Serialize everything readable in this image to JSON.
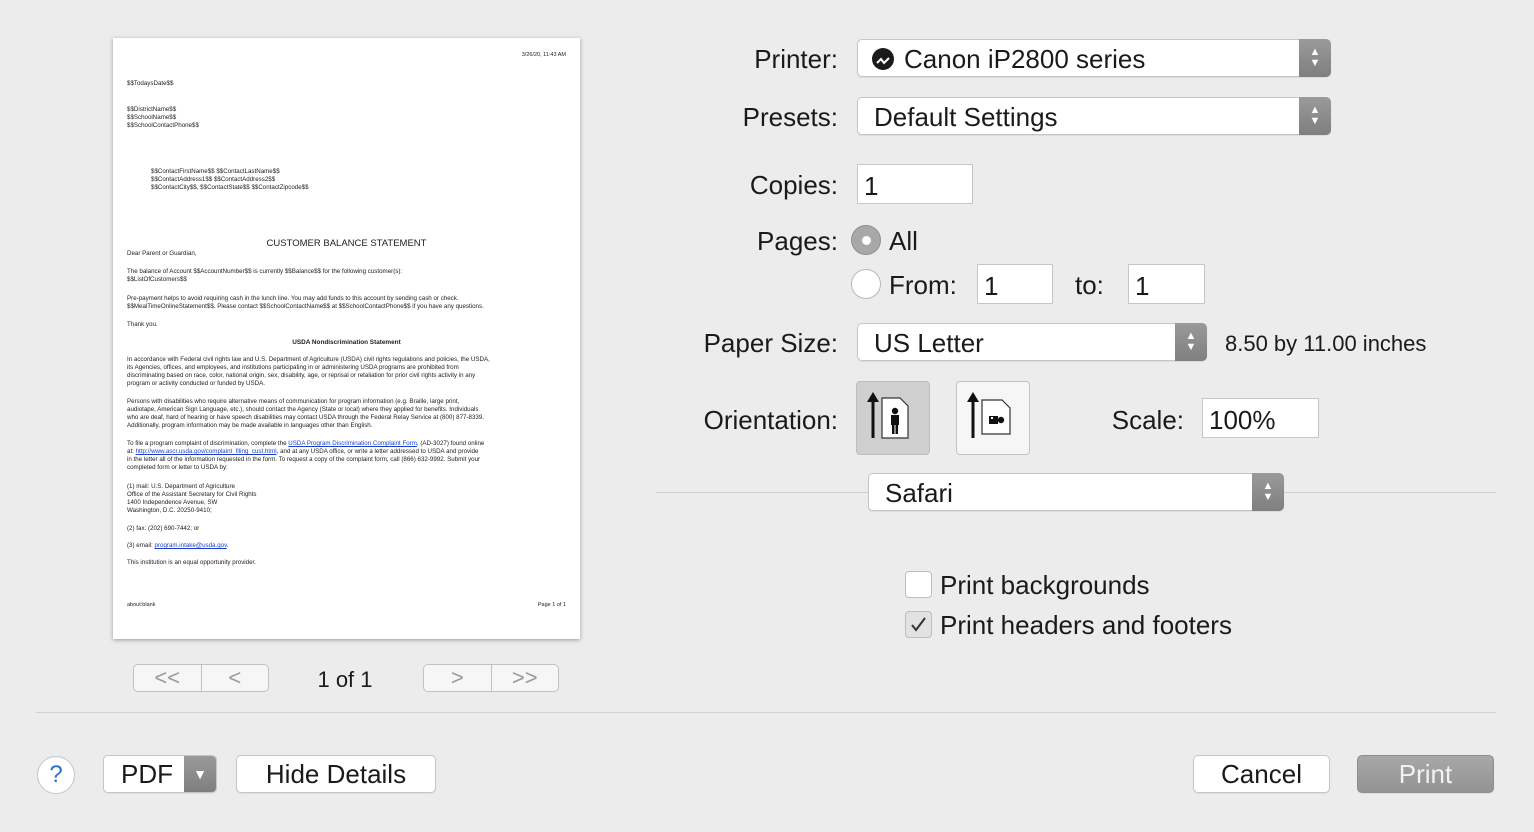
{
  "preview": {
    "timestamp": "3/26/20, 11:43 AM",
    "lines_top": [
      "$$TodaysDate$$",
      "$$DistrictName$$",
      "$$SchoolName$$",
      "$$SchoolContactPhone$$"
    ],
    "address_lines": [
      "$$ContactFirstName$$ $$ContactLastName$$",
      "$$ContactAddress1$$ $$ContactAddress2$$",
      "$$ContactCity$$, $$ContactState$$ $$ContactZipcode$$"
    ],
    "title": "CUSTOMER BALANCE STATEMENT",
    "greeting": "Dear Parent or Guardian,",
    "balance_lines": [
      "The balance of Account $$AccountNumber$$ is currently $$Balance$$ for the following customer(s):",
      "$$ListOfCustomers$$"
    ],
    "prepay_lines": [
      "Pre-payment helps to avoid requiring cash in the lunch line. You may add funds to this account by sending cash or check.",
      "$$MealTimeOnlineStatement$$. Please contact $$SchoolContactName$$ at $$SchoolContactPhone$$ if you have any questions."
    ],
    "thanks": "Thank you.",
    "subtitle": "USDA Nondiscrimination Statement",
    "para1": [
      "In accordance with Federal civil rights law and U.S. Department of Agriculture (USDA) civil rights regulations and policies, the USDA,",
      "its Agencies, offices, and employees, and institutions participating in or administering USDA programs are prohibited from",
      "discriminating based on race, color, national origin, sex, disability, age, or reprisal or retaliation for prior civil rights activity in any",
      "program or activity conducted or funded by USDA."
    ],
    "para2": [
      "Persons with disabilities who require alternative means of communication for program information (e.g. Braille, large print,",
      "audiotape, American Sign Language, etc.), should contact the Agency (State or local) where they applied for benefits. Individuals",
      "who are deaf, hard of hearing or have speech disabilities may contact USDA through the Federal Relay Service at (800) 877-8339.",
      "Additionally, program information may be made available in languages other than English."
    ],
    "para3_pre": "To file a program complaint of discrimination, complete the ",
    "para3_link": "USDA Program Discrimination Complaint Form",
    "para3_post": ", (AD-3027) found online",
    "para3_at": "at: ",
    "para3_link2": "http://www.ascr.usda.gov/complaint_filing_cust.html",
    "para3_post2": ", and at any USDA office, or write a letter addressed to USDA and provide",
    "para3_rest": [
      "in the letter all of the information requested in the form. To request a copy of the complaint form, call (866) 632-9992. Submit your",
      "completed form or letter to USDA by:"
    ],
    "mail_lines": [
      "(1) mail: U.S. Department of Agriculture",
      "Office of the Assistant Secretary for Civil Rights",
      "1400 Independence Avenue, SW",
      "Washington, D.C. 20250-9410;"
    ],
    "fax": "(2) fax: (202) 690-7442; or",
    "email_pre": "(3) email: ",
    "email_link": "program.intake@usda.gov",
    "email_post": ".",
    "equal": "This institution is an equal opportunity provider.",
    "footer_left": "about:blank",
    "footer_right": "Page 1 of 1"
  },
  "nav": {
    "first": "<<",
    "prev": "<",
    "page_indicator": "1 of 1",
    "next": ">",
    "last": ">>"
  },
  "printer": {
    "label": "Printer:",
    "value": "Canon iP2800 series"
  },
  "presets": {
    "label": "Presets:",
    "value": "Default Settings"
  },
  "copies": {
    "label": "Copies:",
    "value": "1"
  },
  "pages": {
    "label": "Pages:",
    "all_label": "All",
    "from_label": "From:",
    "from_value": "1",
    "to_label": "to:",
    "to_value": "1",
    "selected": "all"
  },
  "paper_size": {
    "label": "Paper Size:",
    "value": "US Letter",
    "dimensions": "8.50 by 11.00 inches"
  },
  "orientation": {
    "label": "Orientation:",
    "selected": "portrait"
  },
  "scale": {
    "label": "Scale:",
    "value": "100%"
  },
  "section_popup": {
    "value": "Safari"
  },
  "options": {
    "print_backgrounds": {
      "label": "Print backgrounds",
      "checked": false
    },
    "print_headers_footers": {
      "label": "Print headers and footers",
      "checked": true
    }
  },
  "footer": {
    "help": "?",
    "pdf": "PDF",
    "hide_details": "Hide Details",
    "cancel": "Cancel",
    "print": "Print"
  }
}
